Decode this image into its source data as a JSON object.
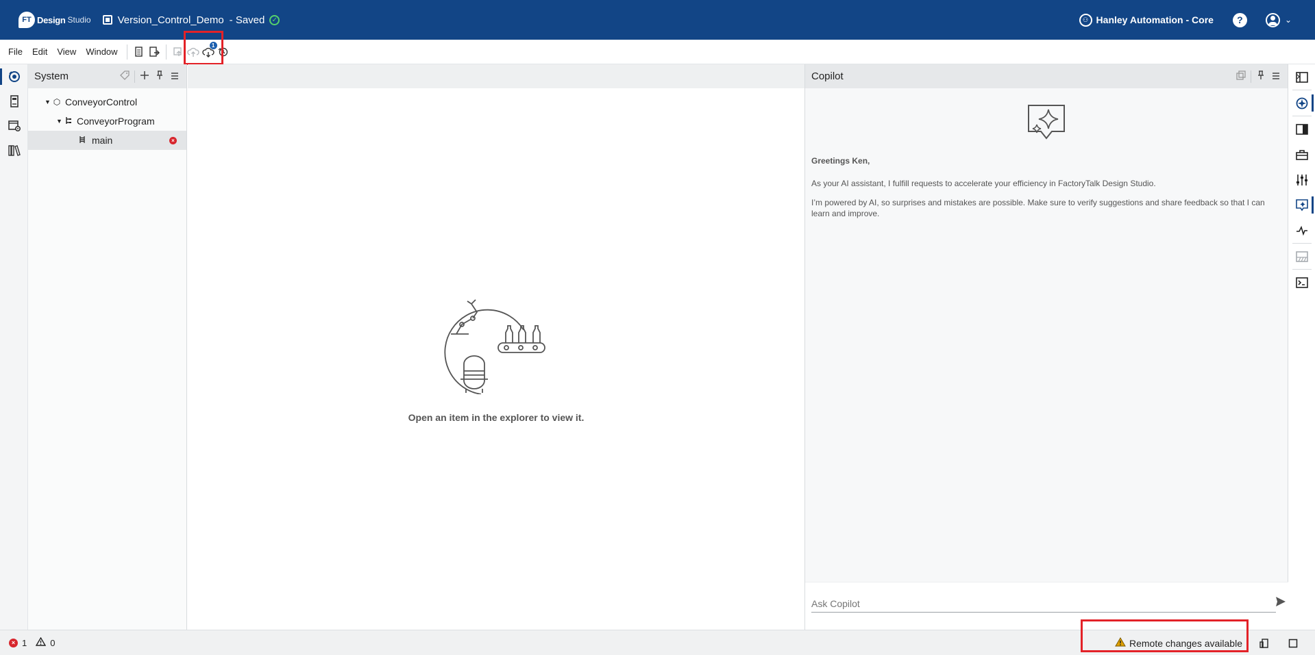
{
  "titlebar": {
    "logo_badge": "FT",
    "logo_word1": "Design",
    "logo_word2": "Studio",
    "project_name": "Version_Control_Demo",
    "project_status": "- Saved",
    "saved_check": "✓",
    "org_icon": "⚇",
    "organization": "Hanley Automation - Core",
    "help": "?",
    "caret": "⌄",
    "color": "#124586"
  },
  "menu": {
    "items": [
      "File",
      "Edit",
      "View",
      "Window"
    ],
    "pull_badge": "1"
  },
  "explorer": {
    "title": "System",
    "tree": [
      {
        "label": "ConveyorControl"
      },
      {
        "label": "ConveyorProgram"
      },
      {
        "label": "main"
      }
    ],
    "error_mark": "×"
  },
  "editor": {
    "empty_message": "Open an item in the explorer to view it."
  },
  "copilot": {
    "title": "Copilot",
    "greeting": "Greetings Ken,",
    "intro": "As your AI assistant, I fulfill requests to accelerate your efficiency in FactoryTalk Design Studio.",
    "disclaimer": "I’m powered by AI, so surprises and mistakes are possible. Make sure to verify suggestions and share feedback so that I can learn and improve.",
    "input_placeholder": "Ask Copilot"
  },
  "statusbar": {
    "error_mark": "×",
    "error_count": "1",
    "warning_count": "0",
    "remote_message": "Remote changes available",
    "warning_color": "#e0a100"
  },
  "icons": {
    "left_rail": [
      "system-explorer-icon",
      "controller-icon",
      "settings-window-icon",
      "library-icon"
    ],
    "right_rail": [
      "panel-toggle-icon",
      "navigation-icon",
      "properties-icon",
      "toolbox-icon",
      "sliders-icon",
      "copilot-icon",
      "trend-icon",
      "disabled-panel-icon",
      "terminal-icon"
    ]
  }
}
